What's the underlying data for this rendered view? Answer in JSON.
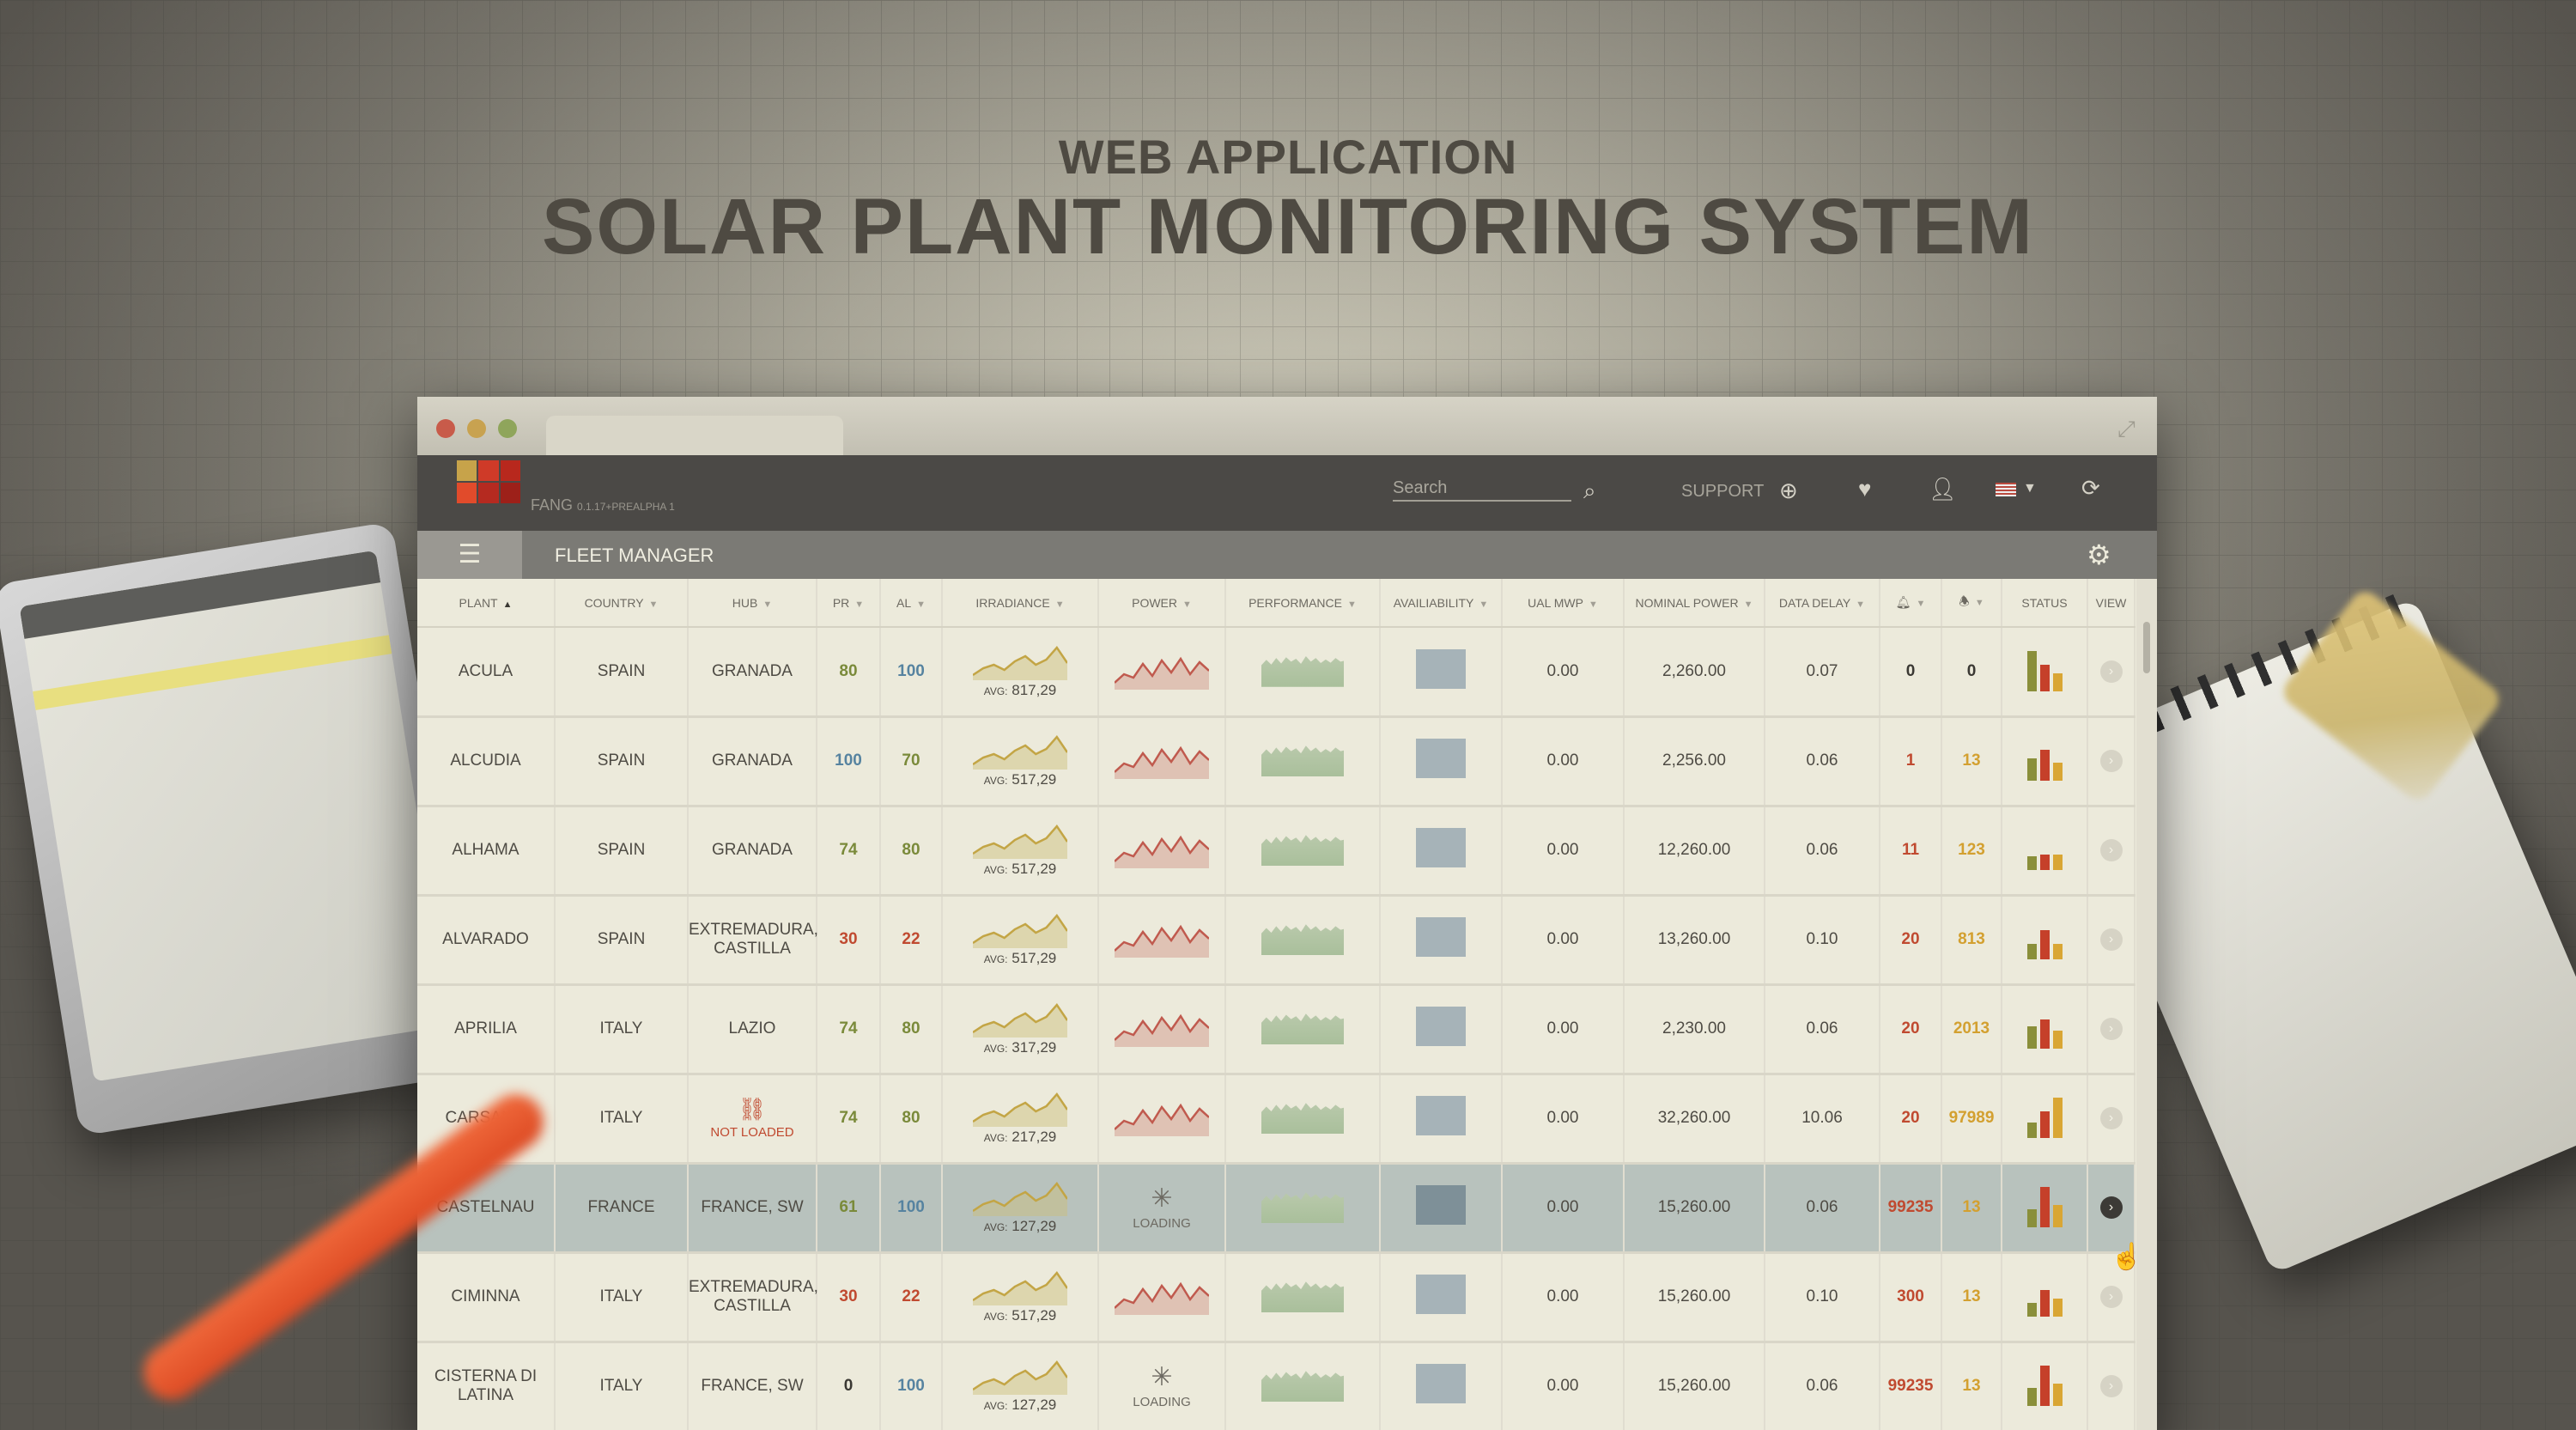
{
  "headline": {
    "kicker": "WEB APPLICATION",
    "title": "SOLAR PLANT MONITORING SYSTEM"
  },
  "header": {
    "brand": "FANG",
    "version": "0.1.17+PREALPHA 1",
    "search_placeholder": "Search",
    "support_label": "SUPPORT",
    "logo_colors": [
      "#c7a34a",
      "#cf3a28",
      "#b8281d",
      "#e14b2b",
      "#b52a20",
      "#9d2019"
    ],
    "icons": [
      "search-icon",
      "support-icon",
      "heart-icon",
      "user-icon",
      "flag-us-icon",
      "refresh-icon"
    ]
  },
  "toolbar": {
    "title": "FLEET MANAGER"
  },
  "table": {
    "columns": [
      {
        "key": "plant",
        "label": "PLANT",
        "sort": "▲"
      },
      {
        "key": "country",
        "label": "COUNTRY"
      },
      {
        "key": "hub",
        "label": "HUB"
      },
      {
        "key": "pr",
        "label": "PR"
      },
      {
        "key": "al",
        "label": "AL"
      },
      {
        "key": "irradiance",
        "label": "IRRADIANCE"
      },
      {
        "key": "power",
        "label": "POWER"
      },
      {
        "key": "performance",
        "label": "PERFORMANCE"
      },
      {
        "key": "availability",
        "label": "AVAILIABILITY"
      },
      {
        "key": "ual",
        "label": "UAL MWP"
      },
      {
        "key": "nominal",
        "label": "NOMINAL POWER"
      },
      {
        "key": "delay",
        "label": "DATA DELAY"
      },
      {
        "key": "alarm",
        "label": "",
        "icon": "bell-filled-icon"
      },
      {
        "key": "alert",
        "label": "",
        "icon": "bell-outline-icon"
      },
      {
        "key": "status",
        "label": "STATUS"
      },
      {
        "key": "view",
        "label": "VIEW"
      }
    ],
    "avg_prefix": "AVG:",
    "loading_text": "LOADING",
    "rows": [
      {
        "plant": "ACULA",
        "country": "SPAIN",
        "hub": "GRANADA",
        "pr": "80",
        "pr_color": "green",
        "al": "100",
        "al_color": "blue",
        "avg": "817,29",
        "power": "chart",
        "ual": "0.00",
        "nominal": "2,260.00",
        "delay": "0.07",
        "alarm": "0",
        "alarm_color": "dark",
        "alert": "0",
        "alert_color": "dark",
        "status": [
          0.9,
          0.6,
          0.4
        ],
        "selected": false
      },
      {
        "plant": "ALCUDIA",
        "country": "SPAIN",
        "hub": "GRANADA",
        "pr": "100",
        "pr_color": "blue",
        "al": "70",
        "al_color": "green",
        "avg": "517,29",
        "power": "chart",
        "ual": "0.00",
        "nominal": "2,256.00",
        "delay": "0.06",
        "alarm": "1",
        "alarm_color": "red",
        "alert": "13",
        "alert_color": "orange",
        "status": [
          0.5,
          0.7,
          0.4
        ],
        "selected": false
      },
      {
        "plant": "ALHAMA",
        "country": "SPAIN",
        "hub": "GRANADA",
        "pr": "74",
        "pr_color": "green",
        "al": "80",
        "al_color": "green",
        "avg": "517,29",
        "power": "chart",
        "ual": "0.00",
        "nominal": "12,260.00",
        "delay": "0.06",
        "alarm": "11",
        "alarm_color": "red",
        "alert": "123",
        "alert_color": "orange",
        "status": [
          0.3,
          0.35,
          0.35
        ],
        "selected": false
      },
      {
        "plant": "ALVARADO",
        "country": "SPAIN",
        "hub": "EXTREMADURA, CASTILLA",
        "pr": "30",
        "pr_color": "red",
        "al": "22",
        "al_color": "red",
        "avg": "517,29",
        "power": "chart",
        "ual": "0.00",
        "nominal": "13,260.00",
        "delay": "0.10",
        "alarm": "20",
        "alarm_color": "red",
        "alert": "813",
        "alert_color": "orange",
        "status": [
          0.35,
          0.65,
          0.35
        ],
        "selected": false
      },
      {
        "plant": "APRILIA",
        "country": "ITALY",
        "hub": "LAZIO",
        "pr": "74",
        "pr_color": "green",
        "al": "80",
        "al_color": "green",
        "avg": "317,29",
        "power": "chart",
        "ual": "0.00",
        "nominal": "2,230.00",
        "delay": "0.06",
        "alarm": "20",
        "alarm_color": "red",
        "alert": "2013",
        "alert_color": "orange",
        "status": [
          0.5,
          0.65,
          0.4
        ],
        "selected": false
      },
      {
        "plant": "CARSANO",
        "country": "ITALY",
        "hub": "",
        "hub_status": "NOT LOADED",
        "pr": "74",
        "pr_color": "green",
        "al": "80",
        "al_color": "green",
        "avg": "217,29",
        "power": "chart",
        "ual": "0.00",
        "nominal": "32,260.00",
        "delay": "10.06",
        "alarm": "20",
        "alarm_color": "red",
        "alert": "97989",
        "alert_color": "orange",
        "status": [
          0.35,
          0.6,
          0.9
        ],
        "selected": false
      },
      {
        "plant": "CASTELNAU",
        "country": "FRANCE",
        "hub": "FRANCE, SW",
        "pr": "61",
        "pr_color": "green",
        "al": "100",
        "al_color": "blue",
        "avg": "127,29",
        "power": "loading",
        "ual": "0.00",
        "nominal": "15,260.00",
        "delay": "0.06",
        "alarm": "99235",
        "alarm_color": "red",
        "alert": "13",
        "alert_color": "orange",
        "status": [
          0.4,
          0.9,
          0.5
        ],
        "selected": true
      },
      {
        "plant": "CIMINNA",
        "country": "ITALY",
        "hub": "EXTREMADURA, CASTILLA",
        "pr": "30",
        "pr_color": "red",
        "al": "22",
        "al_color": "red",
        "avg": "517,29",
        "power": "chart",
        "ual": "0.00",
        "nominal": "15,260.00",
        "delay": "0.10",
        "alarm": "300",
        "alarm_color": "red",
        "alert": "13",
        "alert_color": "orange",
        "status": [
          0.3,
          0.6,
          0.4
        ],
        "selected": false
      },
      {
        "plant": "CISTERNA DI LATINA",
        "country": "ITALY",
        "hub": "FRANCE, SW",
        "pr": "0",
        "pr_color": "dark",
        "al": "100",
        "al_color": "blue",
        "avg": "127,29",
        "power": "loading",
        "ual": "0.00",
        "nominal": "15,260.00",
        "delay": "0.06",
        "alarm": "99235",
        "alarm_color": "red",
        "alert": "13",
        "alert_color": "orange",
        "status": [
          0.4,
          0.9,
          0.5
        ],
        "selected": false
      }
    ]
  },
  "colors": {
    "status_bars": [
      "#8a8f3a",
      "#c5402a",
      "#d9a634"
    ],
    "irradiance": "#c3a545",
    "power": "#c05a4e"
  }
}
